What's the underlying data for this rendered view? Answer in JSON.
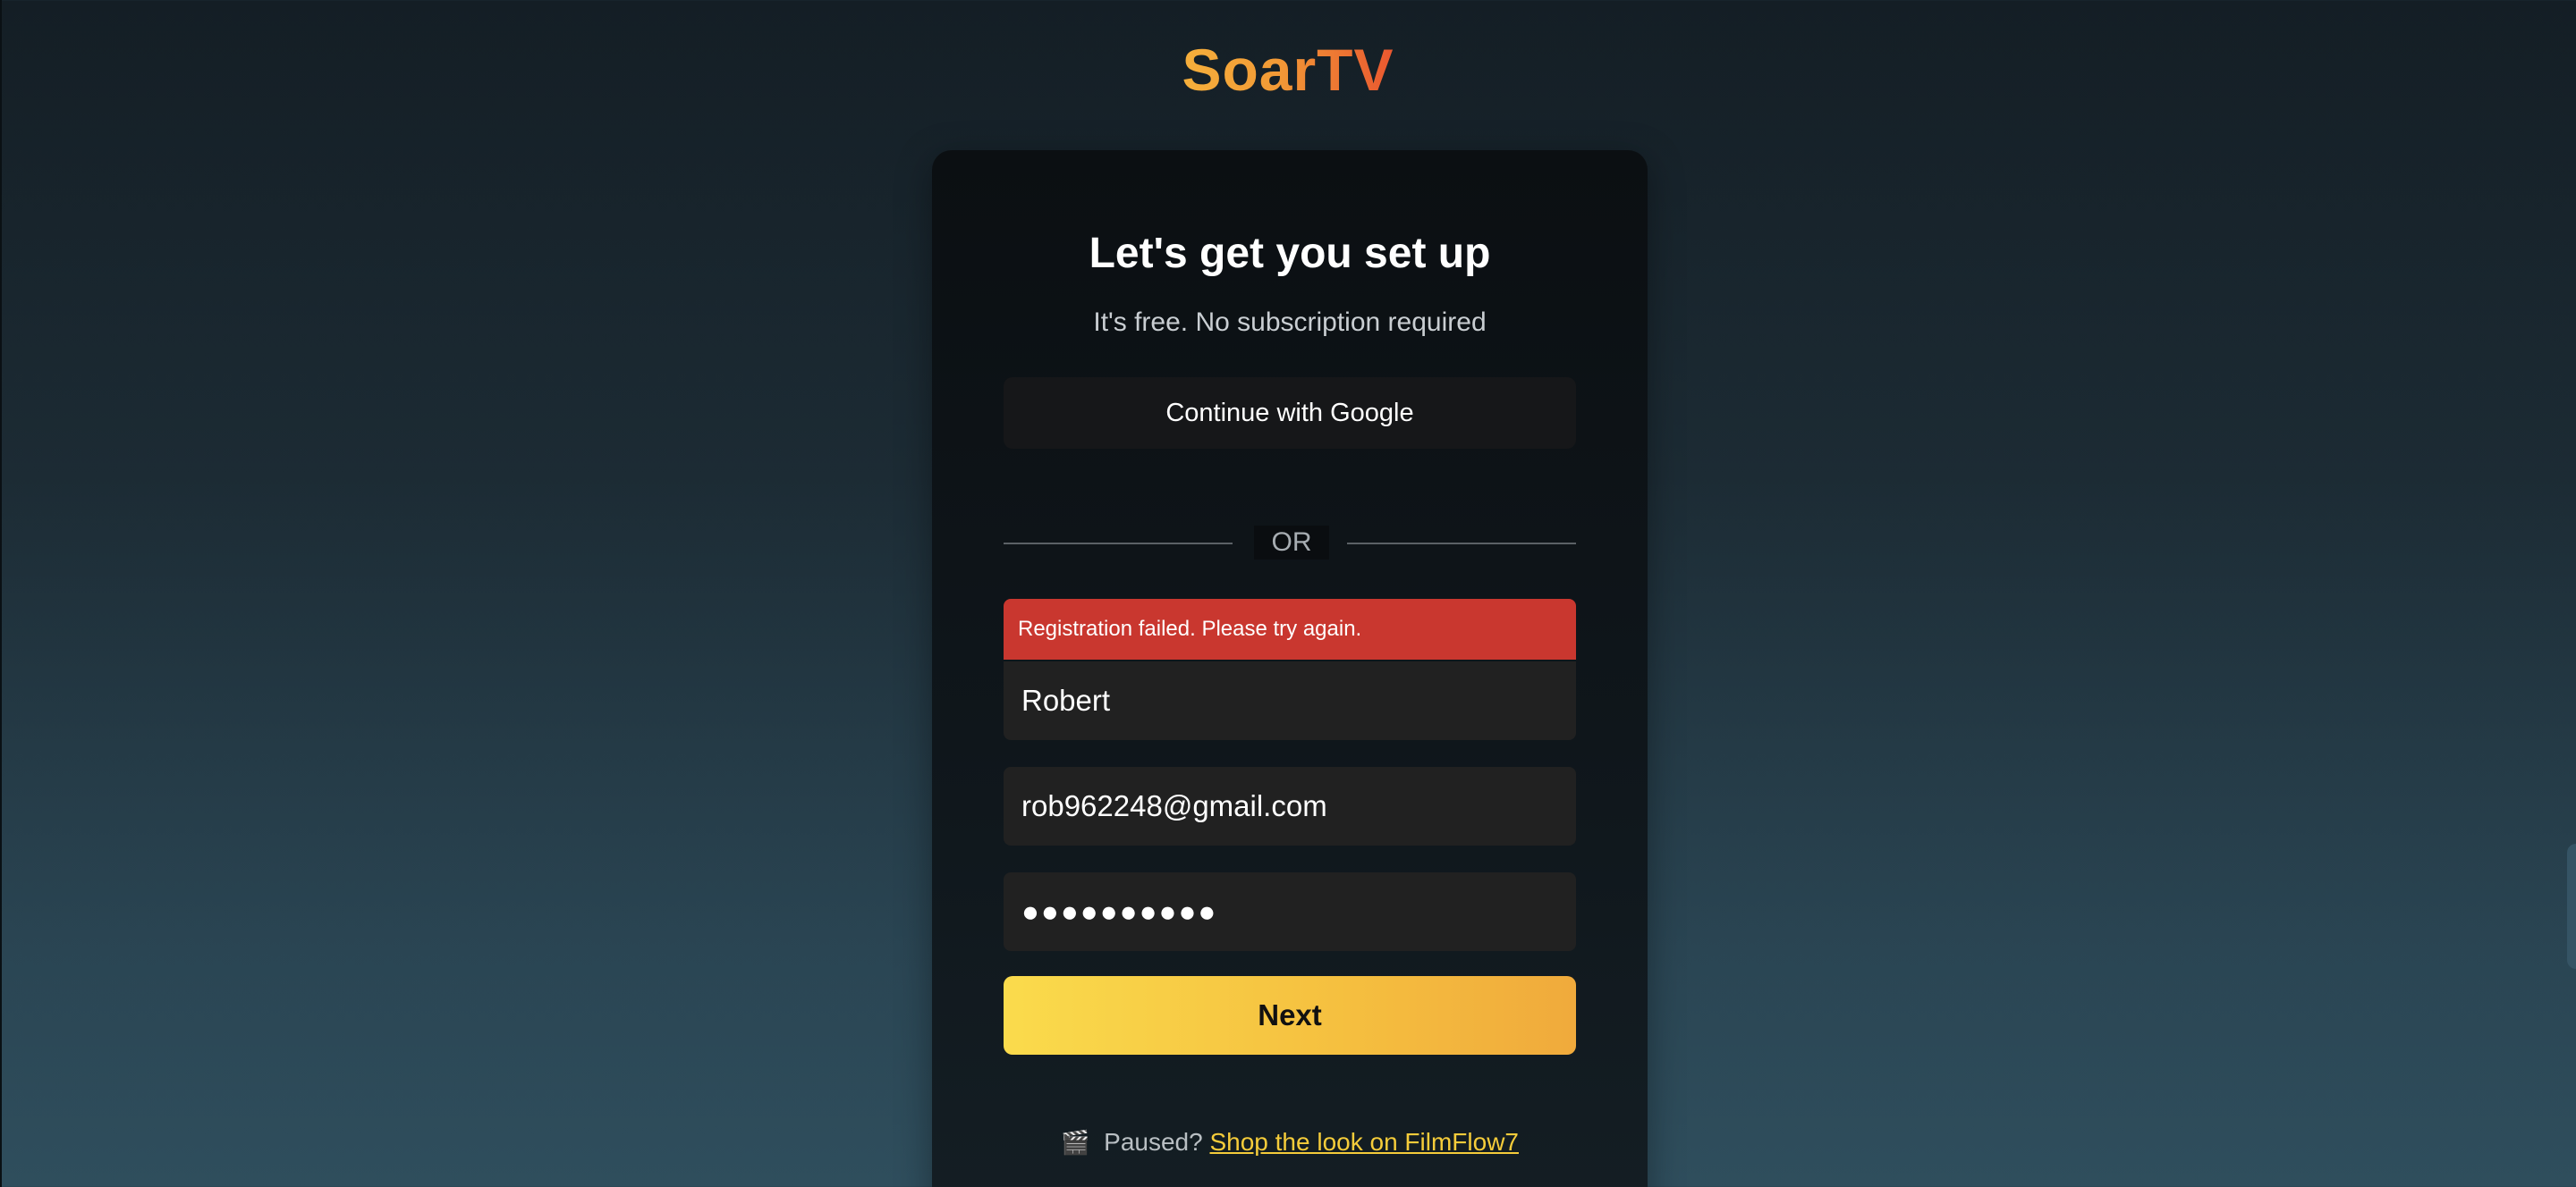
{
  "brand": {
    "logo_text": "SoarTV",
    "gradient_colors": [
      "#f6b23c",
      "#e8512f"
    ]
  },
  "signup": {
    "title": "Let's get you set up",
    "subtitle": "It's free. No subscription required",
    "google_button_label": "Continue with Google",
    "divider_label": "OR",
    "error_message": "Registration failed. Please try again.",
    "name_value": "Robert",
    "email_value": "rob962248@gmail.com",
    "password_value": "●●●●●●●●●●",
    "next_button_label": "Next"
  },
  "promo": {
    "icon": "clapperboard-icon",
    "icon_glyph": "🎬",
    "prefix": "Paused?",
    "link_text": "Shop the look on FilmFlow7"
  },
  "colors": {
    "error_bg": "#c9372f",
    "next_button_start": "#fadb4c",
    "next_button_end": "#f0aa3c",
    "link": "#f5cc3a"
  }
}
